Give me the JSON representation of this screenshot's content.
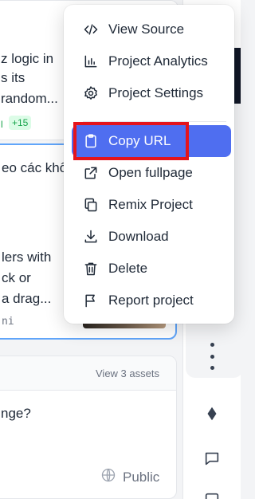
{
  "background": {
    "card1": {
      "line1": "z logic in",
      "line2": "s its",
      "line3": "random...",
      "diff_minus": "l",
      "diff_plus": "+15"
    },
    "card2": {
      "line1": "eo các khối",
      "line2": "lers with",
      "line3": "ck or",
      "line4": "a drag...",
      "author": "ni"
    },
    "card3": {
      "assets_link": "View 3 assets",
      "question": "nge?",
      "visibility": "Public"
    }
  },
  "menu": {
    "items": [
      {
        "label": "View Source",
        "icon": "code-icon"
      },
      {
        "label": "Project Analytics",
        "icon": "bar-chart-icon"
      },
      {
        "label": "Project Settings",
        "icon": "gear-icon"
      },
      {
        "label": "Copy URL",
        "icon": "clipboard-icon"
      },
      {
        "label": "Open fullpage",
        "icon": "external-link-icon"
      },
      {
        "label": "Remix Project",
        "icon": "copy-icon"
      },
      {
        "label": "Download",
        "icon": "download-icon"
      },
      {
        "label": "Delete",
        "icon": "trash-icon"
      },
      {
        "label": "Report project",
        "icon": "flag-icon"
      }
    ],
    "active_item": "Copy URL",
    "accent_color": "#4f6ef0",
    "highlight_color": "#e5141b"
  }
}
